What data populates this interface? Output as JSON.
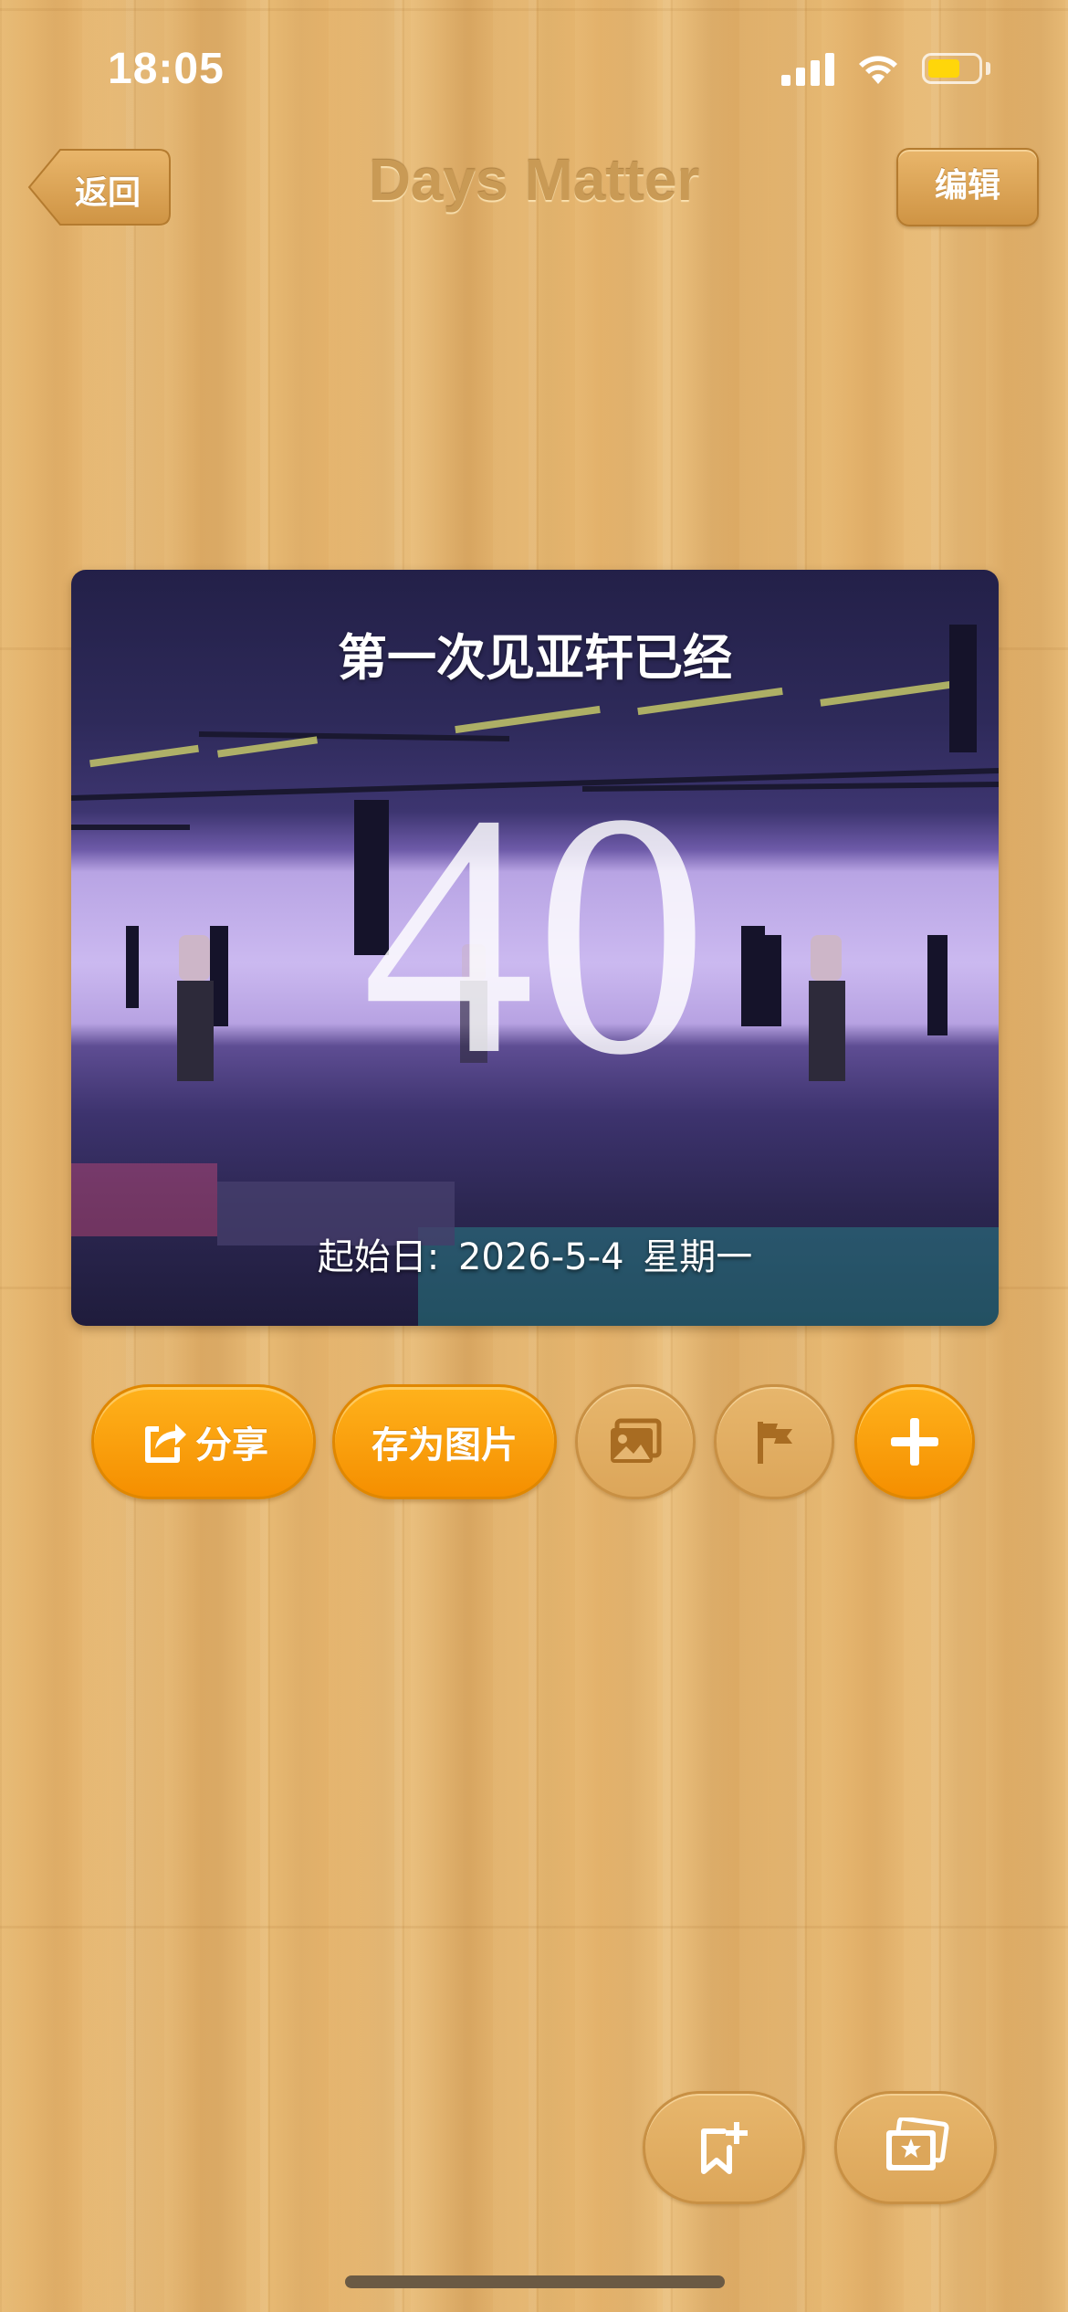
{
  "status_bar": {
    "time": "18:05"
  },
  "nav": {
    "back_label": "返回",
    "title": "Days Matter",
    "edit_label": "编辑"
  },
  "card": {
    "title": "第一次见亚轩已经",
    "days": "40",
    "start_label": "起始日:",
    "start_date": "2026-5-4",
    "weekday": "星期一"
  },
  "actions": {
    "share_label": "分享",
    "save_image_label": "存为图片"
  },
  "icons": [
    "share-icon",
    "image-icon",
    "flag-icon",
    "plus-icon",
    "bookmark-add-icon",
    "photo-card-icon"
  ],
  "colors": {
    "accent_orange": "#f7a20c",
    "wood": "#e5b671",
    "title_brown": "#c99a55",
    "battery": "#ffd60a"
  }
}
